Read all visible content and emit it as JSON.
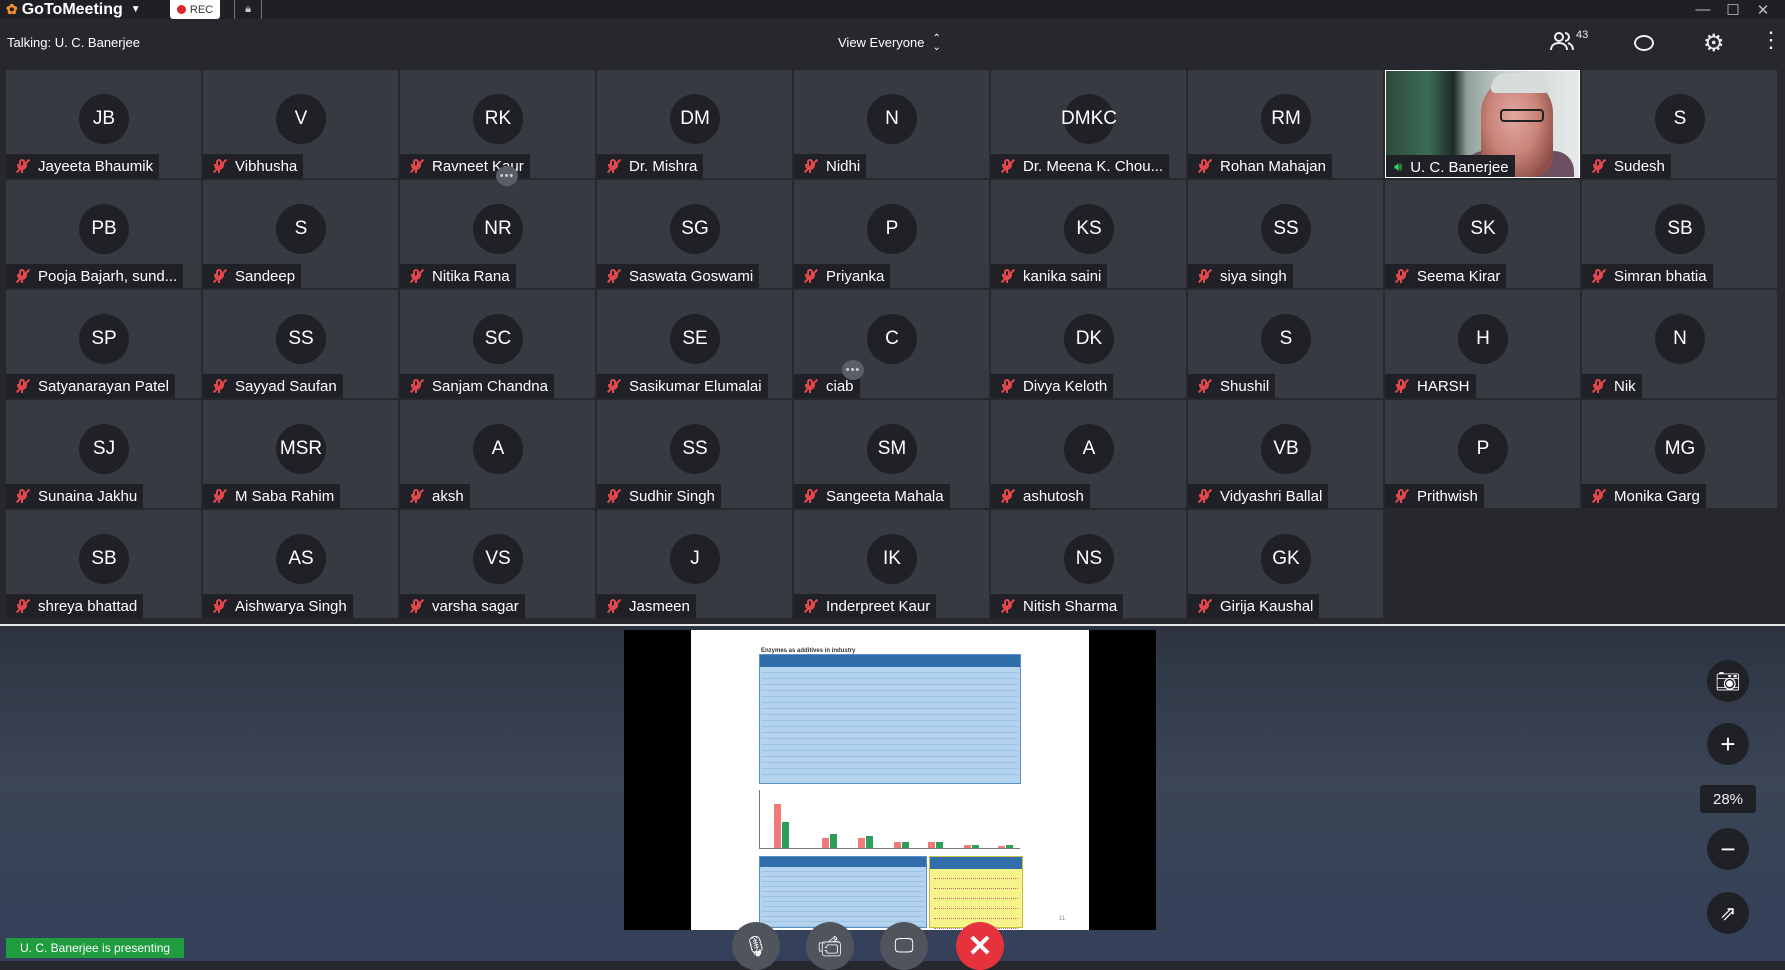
{
  "app": {
    "name": "GoToMeeting",
    "rec_label": "REC"
  },
  "info": {
    "talking": "Talking: U. C. Banerjee",
    "view_label": "View Everyone",
    "attendee_count": "43"
  },
  "participants": [
    {
      "initials": "JB",
      "name": "Jayeeta Bhaumik",
      "muted": true
    },
    {
      "initials": "V",
      "name": "Vibhusha",
      "muted": true
    },
    {
      "initials": "RK",
      "name": "Ravneet Kaur",
      "muted": true
    },
    {
      "initials": "DM",
      "name": "Dr. Mishra",
      "muted": true
    },
    {
      "initials": "N",
      "name": "Nidhi",
      "muted": true
    },
    {
      "initials": "DMKC",
      "name": "Dr. Meena K. Chou...",
      "muted": true
    },
    {
      "initials": "RM",
      "name": "Rohan Mahajan",
      "muted": true
    },
    {
      "initials": "",
      "name": "U. C. Banerjee",
      "muted": false,
      "video": true
    },
    {
      "initials": "S",
      "name": "Sudesh",
      "muted": true
    },
    {
      "initials": "PB",
      "name": "Pooja Bajarh, sund...",
      "muted": true
    },
    {
      "initials": "S",
      "name": "Sandeep",
      "muted": true
    },
    {
      "initials": "NR",
      "name": "Nitika Rana",
      "muted": true
    },
    {
      "initials": "SG",
      "name": "Saswata Goswami",
      "muted": true
    },
    {
      "initials": "P",
      "name": "Priyanka",
      "muted": true
    },
    {
      "initials": "KS",
      "name": "kanika saini",
      "muted": true
    },
    {
      "initials": "SS",
      "name": "siya singh",
      "muted": true
    },
    {
      "initials": "SK",
      "name": "Seema Kirar",
      "muted": true
    },
    {
      "initials": "SB",
      "name": "Simran bhatia",
      "muted": true
    },
    {
      "initials": "SP",
      "name": "Satyanarayan Patel",
      "muted": true
    },
    {
      "initials": "SS",
      "name": "Sayyad Saufan",
      "muted": true
    },
    {
      "initials": "SC",
      "name": "Sanjam Chandna",
      "muted": true
    },
    {
      "initials": "SE",
      "name": "Sasikumar Elumalai",
      "muted": true
    },
    {
      "initials": "C",
      "name": "ciab",
      "muted": true
    },
    {
      "initials": "DK",
      "name": "Divya Keloth",
      "muted": true
    },
    {
      "initials": "S",
      "name": "Shushil",
      "muted": true
    },
    {
      "initials": "H",
      "name": "HARSH",
      "muted": true
    },
    {
      "initials": "N",
      "name": "Nik",
      "muted": true
    },
    {
      "initials": "SJ",
      "name": "Sunaina Jakhu",
      "muted": true
    },
    {
      "initials": "MSR",
      "name": "M Saba  Rahim",
      "muted": true
    },
    {
      "initials": "A",
      "name": "aksh",
      "muted": true
    },
    {
      "initials": "SS",
      "name": "Sudhir Singh",
      "muted": true
    },
    {
      "initials": "SM",
      "name": "Sangeeta Mahala",
      "muted": true
    },
    {
      "initials": "A",
      "name": "ashutosh",
      "muted": true
    },
    {
      "initials": "VB",
      "name": "Vidyashri Ballal",
      "muted": true
    },
    {
      "initials": "P",
      "name": "Prithwish",
      "muted": true
    },
    {
      "initials": "MG",
      "name": "Monika Garg",
      "muted": true
    },
    {
      "initials": "SB",
      "name": "shreya bhattad",
      "muted": true
    },
    {
      "initials": "AS",
      "name": "Aishwarya Singh",
      "muted": true
    },
    {
      "initials": "VS",
      "name": "varsha sagar",
      "muted": true
    },
    {
      "initials": "J",
      "name": "Jasmeen",
      "muted": true
    },
    {
      "initials": "IK",
      "name": "Inderpreet Kaur",
      "muted": true
    },
    {
      "initials": "NS",
      "name": "Nitish Sharma",
      "muted": true
    },
    {
      "initials": "GK",
      "name": "Girija Kaushal",
      "muted": true
    }
  ],
  "slide": {
    "title": "Enzymes as additives in industry",
    "page": "11"
  },
  "controls": {
    "zoom": "28%"
  },
  "status": {
    "presenting": "U. C. Banerjee is presenting"
  },
  "colors": {
    "muted_icon": "#e5484d",
    "speaking_icon": "#37d05e",
    "end_button": "#e5323c",
    "presenting_badge": "#1f9d3e"
  }
}
